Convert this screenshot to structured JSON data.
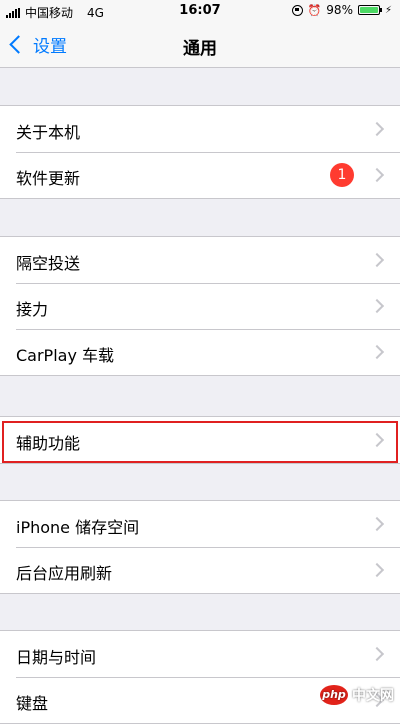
{
  "status_bar": {
    "carrier": "中国移动",
    "network": "4G",
    "time": "16:07",
    "battery_percent": "98%",
    "battery_level": 0.98,
    "battery_color": "#4cd964"
  },
  "nav": {
    "back_label": "设置",
    "title": "通用"
  },
  "groups": [
    {
      "items": [
        {
          "label": "关于本机"
        },
        {
          "label": "软件更新",
          "badge": "1"
        }
      ]
    },
    {
      "items": [
        {
          "label": "隔空投送"
        },
        {
          "label": "接力"
        },
        {
          "label": "CarPlay 车载"
        }
      ]
    },
    {
      "items": [
        {
          "label": "辅助功能",
          "highlighted": true
        }
      ]
    },
    {
      "items": [
        {
          "label": "iPhone 储存空间"
        },
        {
          "label": "后台应用刷新"
        }
      ]
    },
    {
      "items": [
        {
          "label": "日期与时间"
        },
        {
          "label": "键盘"
        }
      ]
    }
  ],
  "watermark": {
    "logo_text": "php",
    "text": "中文网"
  },
  "colors": {
    "accent": "#007aff",
    "badge": "#ff3b30",
    "highlight_border": "#e02020"
  }
}
